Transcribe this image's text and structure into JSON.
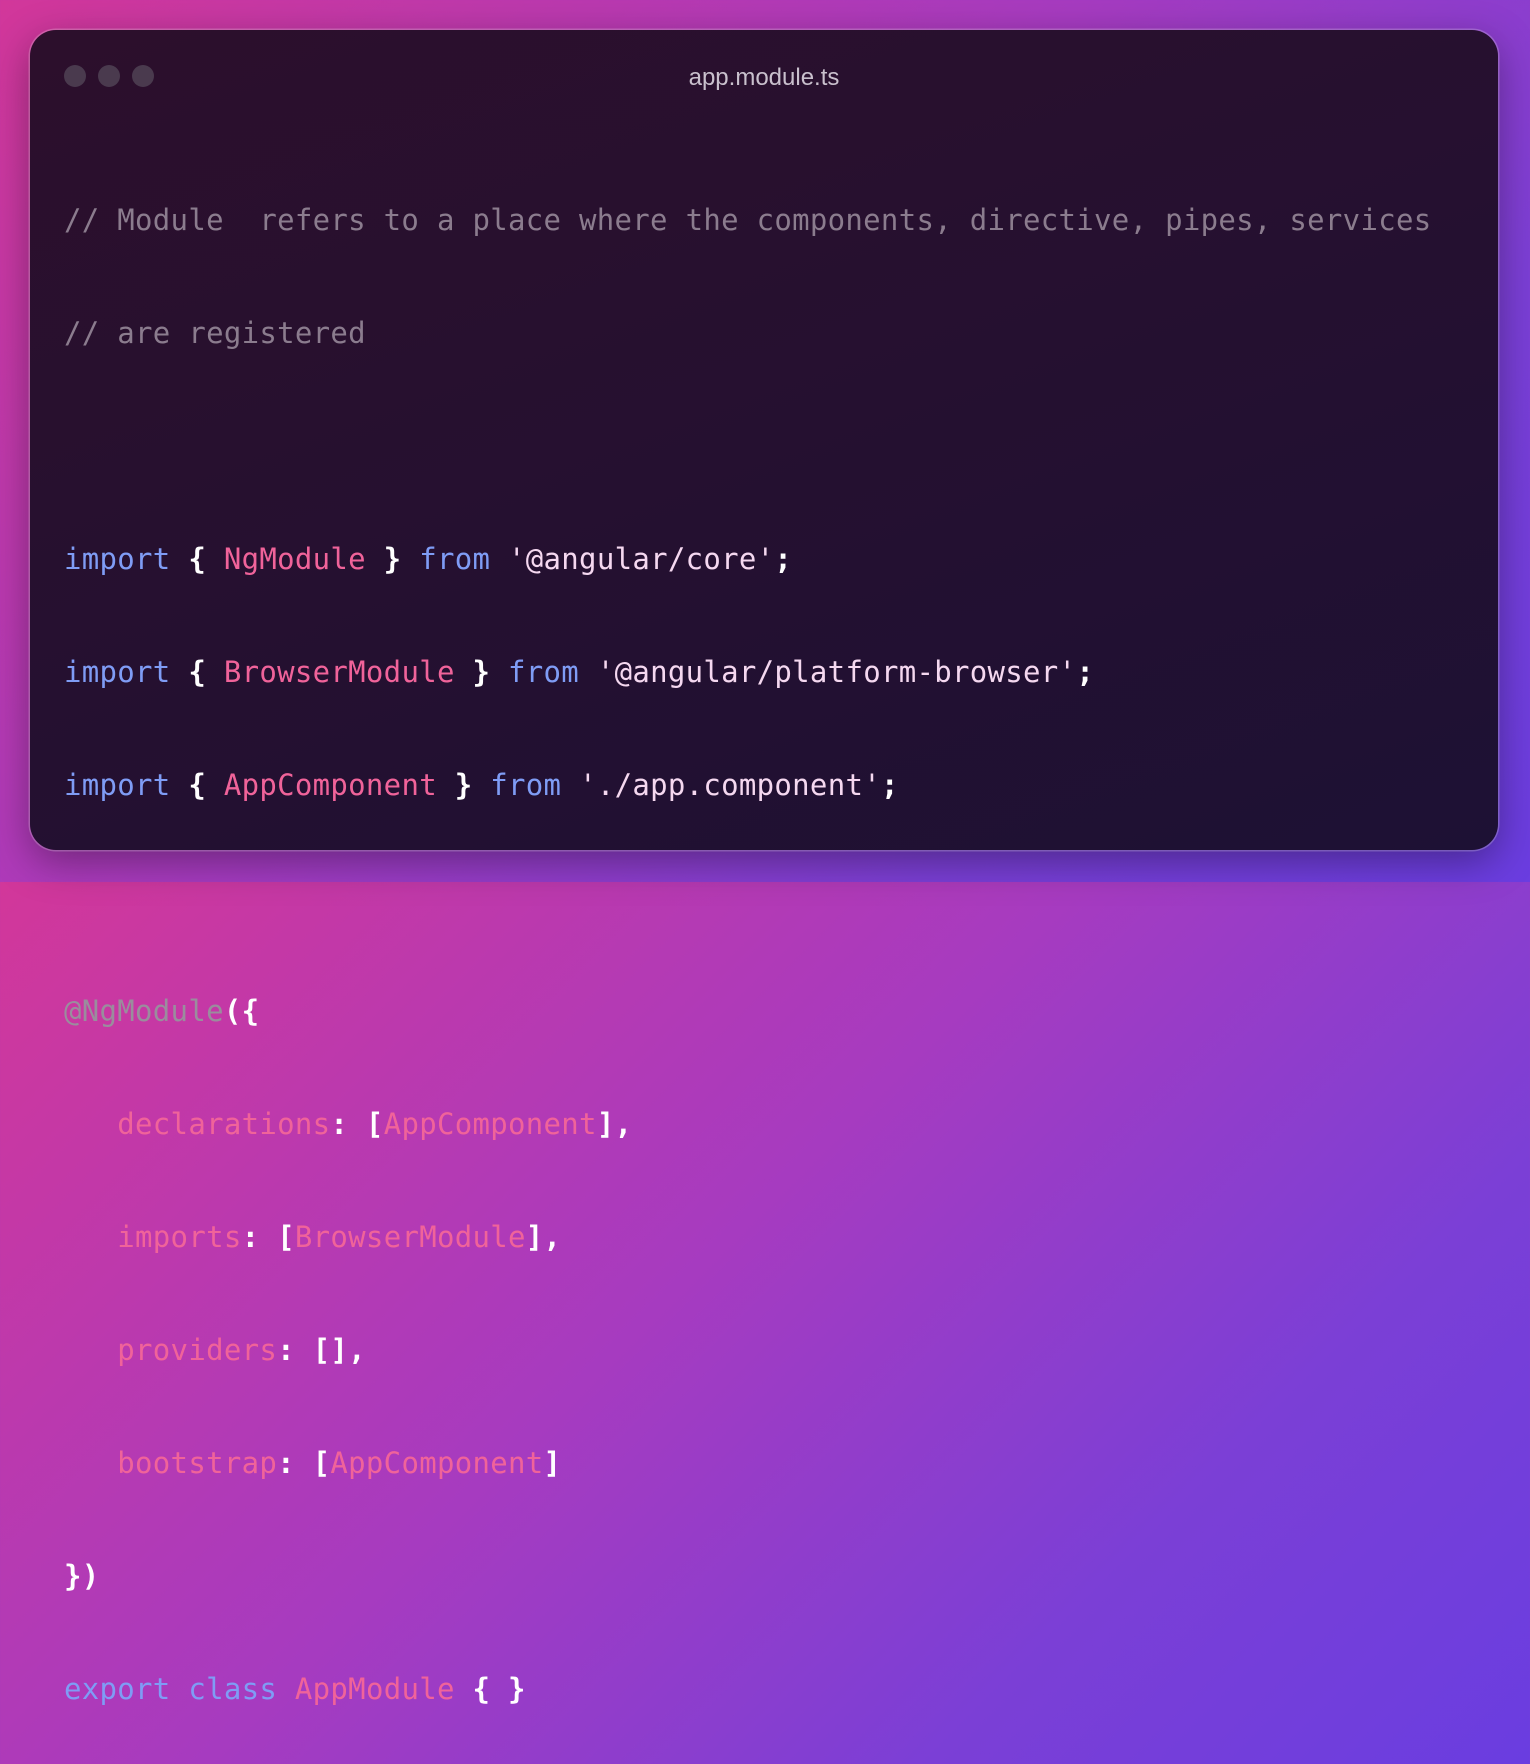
{
  "window": {
    "title": "app.module.ts",
    "controls": [
      "close-dot",
      "minimize-dot",
      "maximize-dot"
    ]
  },
  "colors": {
    "comment": "#8b7c8e",
    "keyword": "#7f9cf5",
    "identifier": "#f0639a",
    "string": "#f5d8f0",
    "punctuation": "#ffffff"
  },
  "code": {
    "comment1": "// Module  refers to a place where the components, directive, pipes, services",
    "comment2": "// are registered",
    "imp1": {
      "kw": "import",
      "open": " { ",
      "name": "NgModule",
      "close": " } ",
      "from": "from",
      "str": "'@angular/core'",
      "end": ";"
    },
    "imp2": {
      "kw": "import",
      "open": " { ",
      "name": "BrowserModule",
      "close": " } ",
      "from": "from",
      "str": "'@angular/platform-browser'",
      "end": ";"
    },
    "imp3": {
      "kw": "import",
      "open": " { ",
      "name": "AppComponent",
      "close": " } ",
      "from": "from",
      "str": "'./app.component'",
      "end": ";"
    },
    "decorator": "@NgModule",
    "decorator_open": "({",
    "declarations": {
      "key": "declarations",
      "sep": ": [",
      "val": "AppComponent",
      "end": "],"
    },
    "imports": {
      "key": "imports",
      "sep": ": [",
      "val": "BrowserModule",
      "end": "],"
    },
    "providers": {
      "key": "providers",
      "sep": ": [],",
      "val": "",
      "end": ""
    },
    "bootstrap": {
      "key": "bootstrap",
      "sep": ": [",
      "val": "AppComponent",
      "end": "]"
    },
    "closing": "})",
    "exp": {
      "kw1": "export",
      "kw2": "class",
      "name": "AppModule",
      "body": "{ }"
    }
  }
}
